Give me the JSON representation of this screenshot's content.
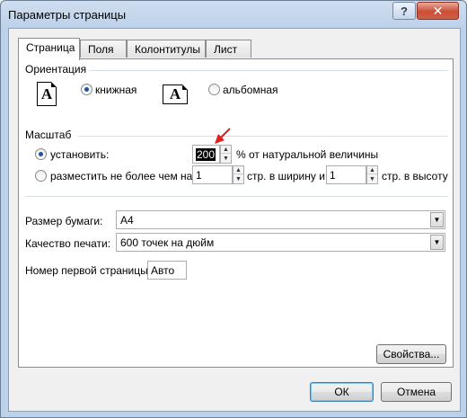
{
  "window": {
    "title": "Параметры страницы",
    "help_label": "?",
    "close_label": "✕"
  },
  "tabs": [
    {
      "label": "Страница",
      "active": true
    },
    {
      "label": "Поля",
      "active": false
    },
    {
      "label": "Колонтитулы",
      "active": false
    },
    {
      "label": "Лист",
      "active": false
    }
  ],
  "orientation": {
    "title": "Ориентация",
    "portrait_label": "книжная",
    "portrait_checked": true,
    "portrait_glyph": "A",
    "landscape_label": "альбомная",
    "landscape_checked": false,
    "landscape_glyph": "A"
  },
  "scale": {
    "title": "Масштаб",
    "set_label": "установить:",
    "set_checked": true,
    "percent_value": "200",
    "percent_suffix": "% от натуральной величины",
    "fit_label": "разместить не более чем на:",
    "fit_checked": false,
    "pages_wide_value": "1",
    "pages_wide_suffix": "стр. в ширину и",
    "pages_tall_value": "1",
    "pages_tall_suffix": "стр. в высоту"
  },
  "paper": {
    "size_label": "Размер бумаги:",
    "size_value": "A4",
    "quality_label": "Качество печати:",
    "quality_value": "600 точек на дюйм",
    "first_page_label": "Номер первой страницы:",
    "first_page_value": "Авто"
  },
  "buttons": {
    "properties": "Свойства...",
    "ok": "ОК",
    "cancel": "Отмена"
  },
  "colors": {
    "annotation_arrow": "#e0201b",
    "accent": "#1e50a8"
  }
}
